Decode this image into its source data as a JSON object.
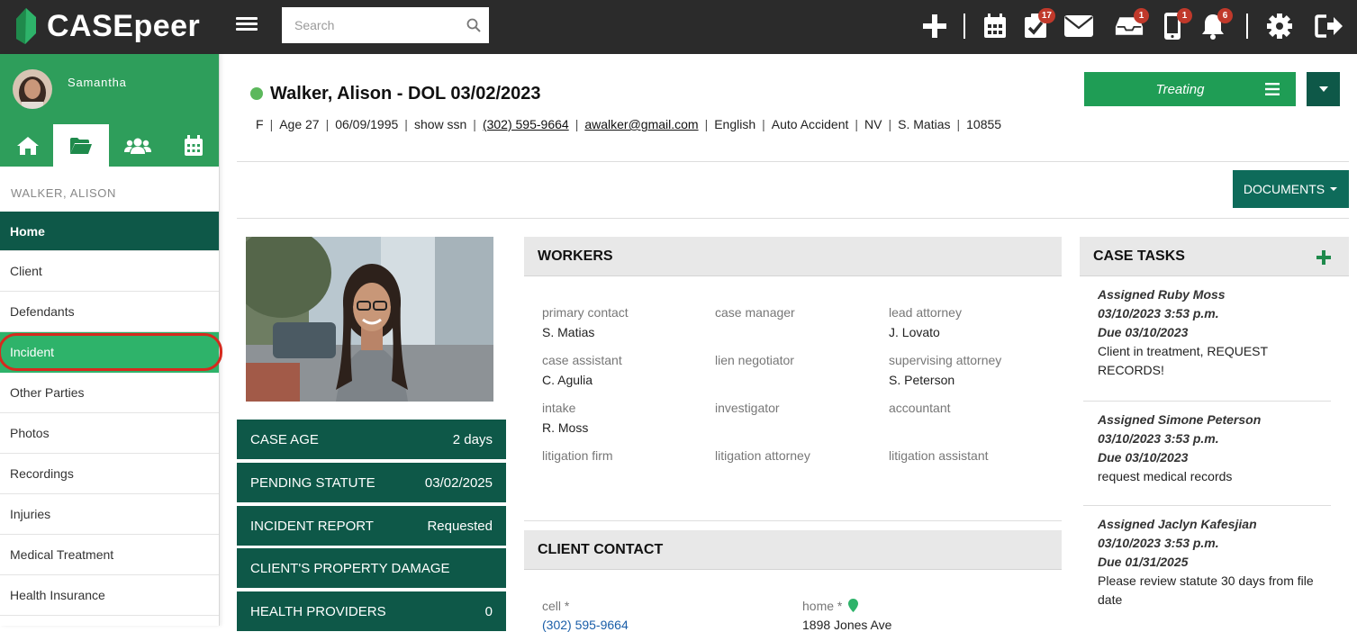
{
  "app": {
    "logo_text": "CASEpeer"
  },
  "search": {
    "placeholder": "Search"
  },
  "topbar": {
    "badges": {
      "tasks": "17",
      "inbox": "1",
      "phone": "1",
      "notifications": "6"
    }
  },
  "user": {
    "name": "Samantha"
  },
  "case": {
    "name": "WALKER, ALISON"
  },
  "nav": {
    "items": [
      {
        "label": "Home"
      },
      {
        "label": "Client"
      },
      {
        "label": "Defendants"
      },
      {
        "label": "Incident"
      },
      {
        "label": "Other Parties"
      },
      {
        "label": "Photos"
      },
      {
        "label": "Recordings"
      },
      {
        "label": "Injuries"
      },
      {
        "label": "Medical Treatment"
      },
      {
        "label": "Health Insurance"
      }
    ]
  },
  "client": {
    "title": "Walker, Alison - DOL 03/02/2023",
    "gender": "F",
    "age": "Age 27",
    "dob": "06/09/1995",
    "ssn": "show ssn",
    "phone": "(302) 595-9664",
    "email": "awalker@gmail.com",
    "language": "English",
    "case_type": "Auto Accident",
    "state": "NV",
    "staff": "S. Matias",
    "case_id": "10855"
  },
  "status": {
    "label": "Treating"
  },
  "documents_label": "DOCUMENTS",
  "stats": [
    {
      "label": "CASE AGE",
      "value": "2 days"
    },
    {
      "label": "PENDING STATUTE",
      "value": "03/02/2025"
    },
    {
      "label": "INCIDENT REPORT",
      "value": "Requested"
    },
    {
      "label": "CLIENT'S PROPERTY DAMAGE",
      "value": ""
    },
    {
      "label": "HEALTH PROVIDERS",
      "value": "0"
    }
  ],
  "workers": {
    "title": "WORKERS",
    "fields": [
      {
        "label": "primary contact",
        "value": "S. Matias"
      },
      {
        "label": "case manager",
        "value": ""
      },
      {
        "label": "lead attorney",
        "value": "J. Lovato"
      },
      {
        "label": "case assistant",
        "value": "C. Agulia"
      },
      {
        "label": "lien negotiator",
        "value": ""
      },
      {
        "label": "supervising attorney",
        "value": "S. Peterson"
      },
      {
        "label": "intake",
        "value": "R. Moss"
      },
      {
        "label": "investigator",
        "value": ""
      },
      {
        "label": "accountant",
        "value": ""
      },
      {
        "label": "litigation firm",
        "value": ""
      },
      {
        "label": "litigation attorney",
        "value": ""
      },
      {
        "label": "litigation assistant",
        "value": ""
      }
    ]
  },
  "client_contact": {
    "title": "CLIENT CONTACT",
    "cell_label": "cell *",
    "cell_value": "(302) 595-9664",
    "home_label": "home *",
    "home_value": "1898 Jones Ave"
  },
  "case_tasks": {
    "title": "CASE TASKS",
    "tasks": [
      {
        "assigned": "Assigned Ruby Moss",
        "created": "03/10/2023 3:53 p.m.",
        "due": "Due 03/10/2023",
        "desc": "Client in treatment, REQUEST RECORDS!"
      },
      {
        "assigned": "Assigned Simone Peterson",
        "created": "03/10/2023 3:53 p.m.",
        "due": "Due 03/10/2023",
        "desc": "request medical records"
      },
      {
        "assigned": "Assigned Jaclyn Kafesjian",
        "created": "03/10/2023 3:53 p.m.",
        "due": "Due 01/31/2025",
        "desc": "Please review statute 30 days from file date"
      }
    ]
  },
  "colors": {
    "dark_green": "#0e5848",
    "green": "#2e9e5b",
    "highlight_ring": "#d62a1e"
  }
}
